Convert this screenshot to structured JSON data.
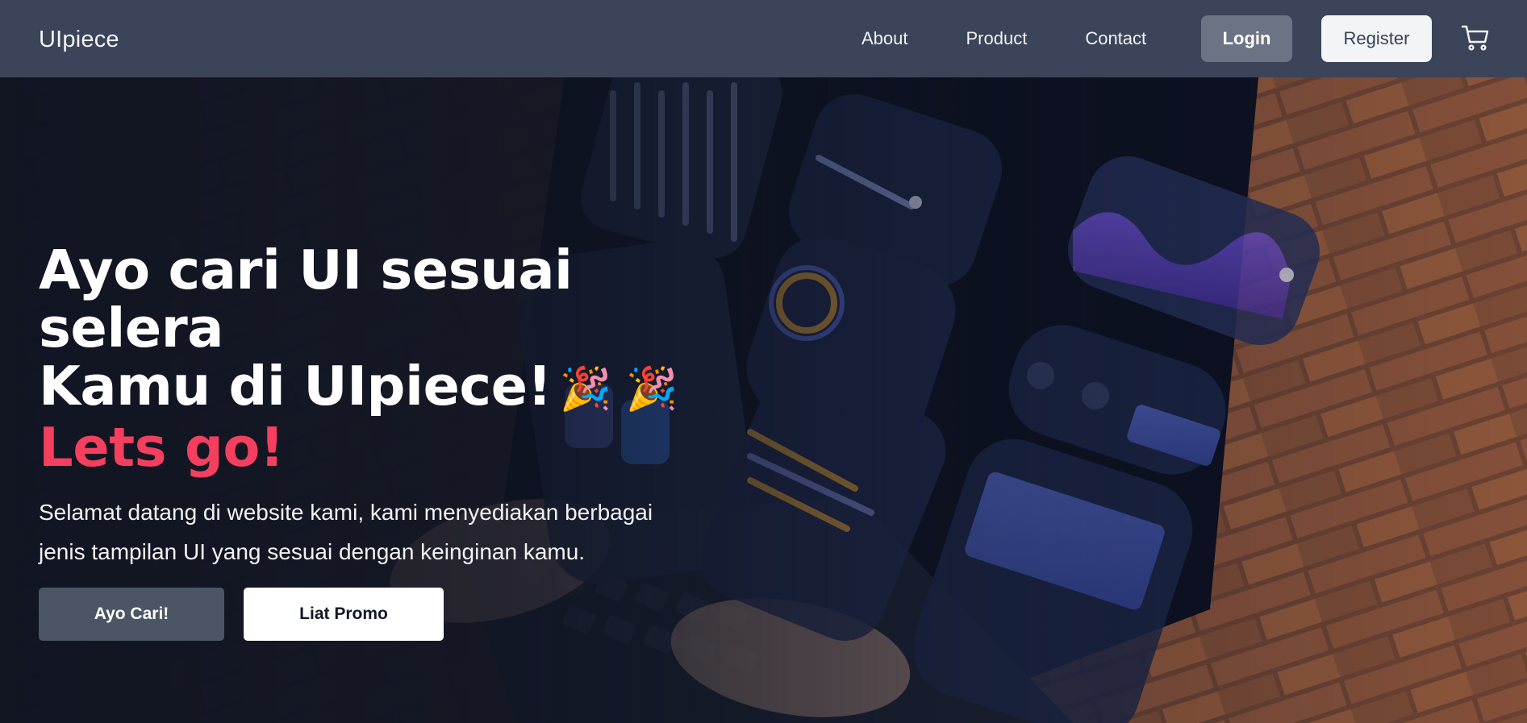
{
  "nav": {
    "brand": "UIpiece",
    "links": [
      "About",
      "Product",
      "Contact"
    ],
    "login_label": "Login",
    "register_label": "Register",
    "cart_icon": "cart-icon"
  },
  "hero": {
    "headline_line1": "Ayo cari UI sesuai selera",
    "headline_line2": "Kamu di UIpiece!",
    "emoji": "🎉 🎉",
    "headline_accent": "Lets go!",
    "description": "Selamat datang di website kami, kami menyediakan berbagai jenis tampilan UI yang sesuai dengan keinginan kamu.",
    "primary_button": "Ayo Cari!",
    "secondary_button": "Liat Promo",
    "background_image": "laptop-dashboard-photo"
  },
  "colors": {
    "navbar": "#3b4458",
    "accent": "#f43f5e",
    "login_button": "#6b7384",
    "primary_button": "#4b5563"
  }
}
